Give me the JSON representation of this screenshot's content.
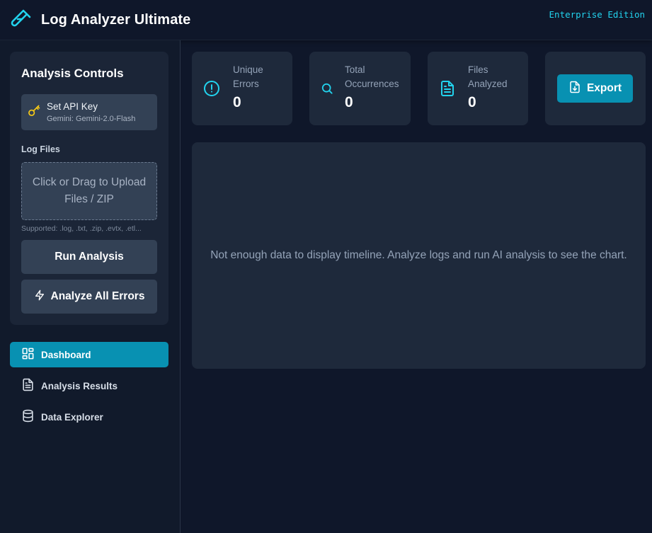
{
  "header": {
    "title": "Log Analyzer Ultimate",
    "edition": "Enterprise Edition",
    "logo_icon": "test-tube-icon"
  },
  "sidebar": {
    "controls": {
      "title": "Analysis Controls",
      "api_key": {
        "label": "Set API Key",
        "model": "Gemini: Gemini-2.0-Flash",
        "icon": "key-icon"
      },
      "log_files_label": "Log Files",
      "upload": {
        "text": "Click or Drag to Upload Files / ZIP",
        "supported": "Supported: .log, .txt, .zip, .evtx, .etl..."
      },
      "run_label": "Run Analysis",
      "analyze_all_label": "Analyze All Errors",
      "analyze_all_icon": "lightning-icon"
    },
    "nav": [
      {
        "label": "Dashboard",
        "icon": "dashboard-icon",
        "active": true
      },
      {
        "label": "Analysis Results",
        "icon": "document-icon",
        "active": false
      },
      {
        "label": "Data Explorer",
        "icon": "database-icon",
        "active": false
      }
    ]
  },
  "stats": [
    {
      "label_line1": "Unique",
      "label_line2": "Errors",
      "value": "0",
      "icon": "alert-circle-icon"
    },
    {
      "label_line1": "Total",
      "label_line2": "Occurrences",
      "value": "0",
      "icon": "search-icon"
    },
    {
      "label_line1": "Files",
      "label_line2": "Analyzed",
      "value": "0",
      "icon": "file-text-icon"
    }
  ],
  "export": {
    "label": "Export",
    "icon": "file-download-icon"
  },
  "chart": {
    "empty_message": "Not enough data to display timeline. Analyze logs and run AI analysis to see the chart."
  },
  "colors": {
    "background": "#0f172a",
    "sidebar": "#111a2b",
    "card": "#1e293b",
    "button": "#334155",
    "accent": "#0891b2",
    "accent_text": "#22d3ee",
    "key_icon": "#facc15"
  }
}
